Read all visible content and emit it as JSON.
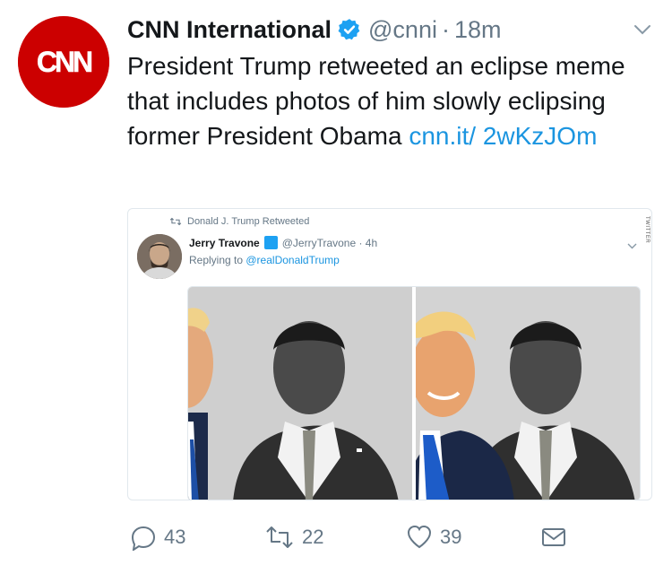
{
  "tweet": {
    "author": {
      "display_name": "CNN International",
      "handle": "@cnni",
      "separator": "·",
      "time": "18m",
      "avatar_logo_text": "CNN"
    },
    "text": "President Trump retweeted an eclipse meme that includes photos of him slowly eclipsing former President Obama ",
    "link_text": "cnn.it/ 2wKzJOm",
    "actions": {
      "replies": "43",
      "retweets": "22",
      "likes": "39"
    }
  },
  "embedded": {
    "retweeted_by": "Donald J. Trump Retweeted",
    "author_name": "Jerry Travone",
    "author_handle": "@JerryTravone · 4h",
    "replying_prefix": "Replying to ",
    "replying_to": "@realDonaldTrump",
    "watermark": "TWITTER"
  },
  "colors": {
    "brand_red": "#cc0000",
    "link": "#1b95e0",
    "muted": "#657786",
    "verified": "#1da1f2"
  }
}
